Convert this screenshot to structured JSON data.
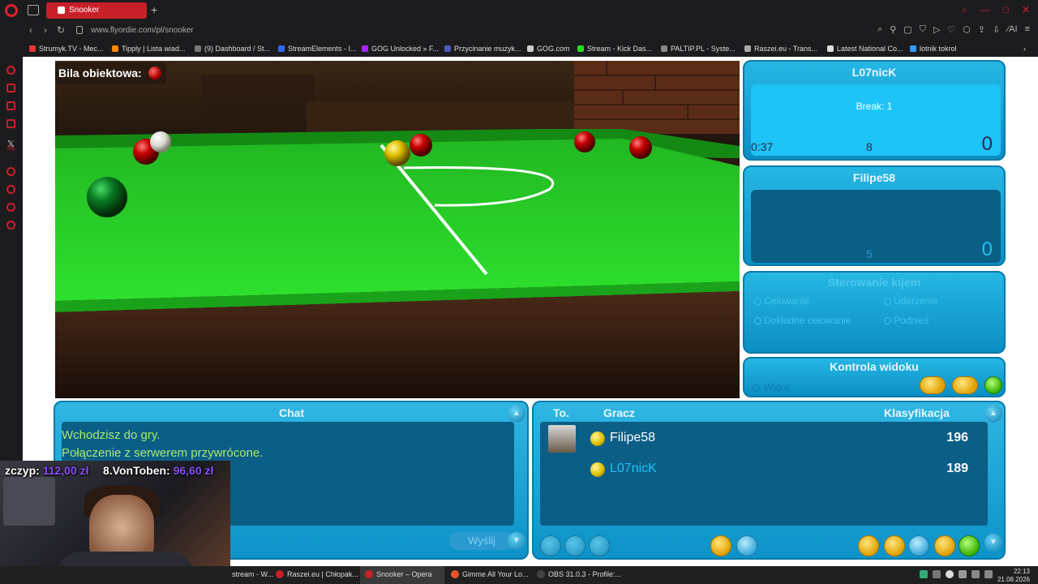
{
  "browser": {
    "tab_title": "Snooker",
    "url": "www.flyordie.com/pl/snooker",
    "bookmarks": [
      "Strumyk.TV - Mec...",
      "Tipply | Lista wiad...",
      "(9) Dashboard / St...",
      "StreamElements - I...",
      "GOG Unlocked » F...",
      "Przycinanie muzyk...",
      "GOG.com",
      "Stream - Kick Das...",
      "PALTIP.PL - Syste...",
      "Raszei.eu - Trans...",
      "Latest National Co...",
      "lotnik tokrol"
    ]
  },
  "game": {
    "object_ball_label": "Bila obiektowa:",
    "player1": {
      "name": "L07nicK",
      "break": "Break: 1",
      "timer": "0:37",
      "middle_number": "8",
      "score": "0"
    },
    "player2": {
      "name": "Filipe58",
      "middle_number": "5",
      "score": "0"
    },
    "cue_control": {
      "title": "Sterowanie kijem",
      "options": [
        "Celowanie",
        "Uderzenie",
        "Dokładne celowanie",
        "Podnieś"
      ]
    },
    "view_control": {
      "title": "Kontrola widoku",
      "option": "Widok"
    },
    "chat": {
      "title": "Chat",
      "messages": [
        "Wchodzisz do gry.",
        "Połączenie z serwerem przywrócone."
      ],
      "send_label": "Wyślij"
    },
    "players_list": {
      "col_to": "To.",
      "col_player": "Gracz",
      "col_rank": "Klasyfikacja",
      "rows": [
        {
          "name": "Filipe58",
          "rank": "196",
          "name_color": "#ffffff"
        },
        {
          "name": "L07nicK",
          "rank": "189",
          "name_color": "#1ec3f8"
        }
      ]
    }
  },
  "stream_overlay": {
    "donations": [
      {
        "name": "zczyp:",
        "amount": "112,00 zł"
      },
      {
        "name": "8.VonToben:",
        "amount": "96,60 zł"
      }
    ]
  },
  "taskbar": {
    "items": [
      "stream - W...",
      "Raszei.eu | Chłopak...",
      "Snooker – Opera",
      "Gimme All Your Lo...",
      "OBS 31.0.3 - Profile:..."
    ],
    "time": "22:13",
    "date": "21.08.2026"
  },
  "colors": {
    "panel_blue": "#1ec3f8",
    "felt_green": "#2ee12e",
    "opera_red": "#c8202a"
  }
}
